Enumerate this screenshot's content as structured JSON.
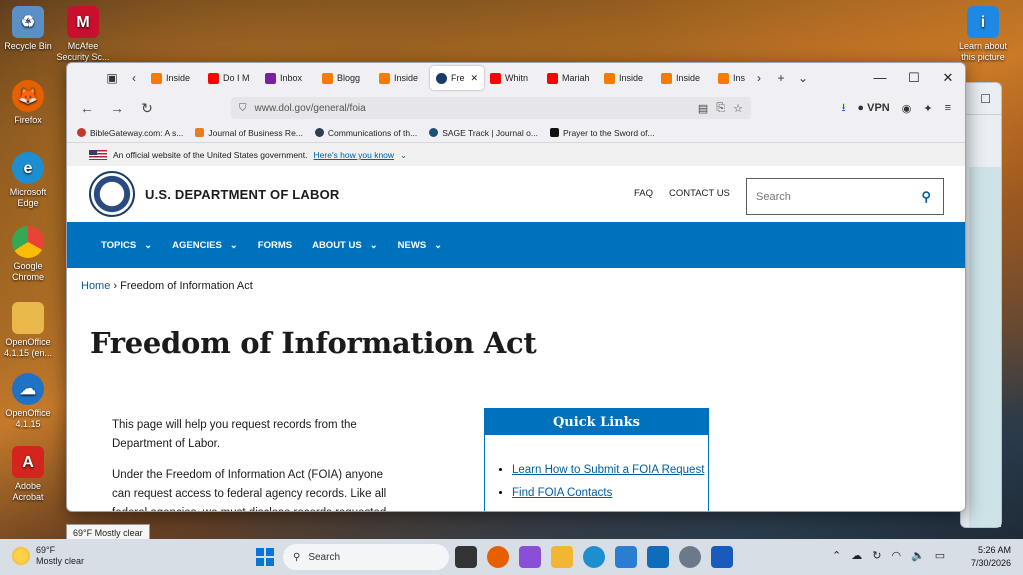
{
  "desktop": {
    "icons": [
      {
        "label": "Recycle Bin",
        "icon": "recycle-bin-icon",
        "color": "#5a8fc8"
      },
      {
        "label": "McAfee Security Sc...",
        "icon": "mcafee-icon",
        "color": "#c8102e"
      },
      {
        "label": "Firefox",
        "icon": "firefox-icon",
        "color": "#e66000"
      },
      {
        "label": "Microsoft Edge",
        "icon": "edge-icon",
        "color": "#1d8ecf"
      },
      {
        "label": "Google Chrome",
        "icon": "chrome-icon",
        "color": "#34a853"
      },
      {
        "label": "OpenOffice 4.1.15 (en...",
        "icon": "folder-icon",
        "color": "#e8b84a"
      },
      {
        "label": "OpenOffice 4.1.15",
        "icon": "openoffice-icon",
        "color": "#1f72c4"
      },
      {
        "label": "Adobe Acrobat",
        "icon": "acrobat-icon",
        "color": "#d4251c"
      },
      {
        "label": "Learn about this picture",
        "icon": "learn-picture-icon",
        "color": "#1e88e5"
      }
    ]
  },
  "browser": {
    "tabs": [
      {
        "label": "Inside",
        "color": "#f57c00",
        "active": false
      },
      {
        "label": "Do I M",
        "color": "#ff0000",
        "active": false
      },
      {
        "label": "Inbox",
        "color": "#7b1fa2",
        "active": false
      },
      {
        "label": "Blogg",
        "color": "#f57c00",
        "active": false
      },
      {
        "label": "Inside",
        "color": "#f57c00",
        "active": false
      },
      {
        "label": "Fre",
        "color": "#1a3a6a",
        "active": true
      },
      {
        "label": "Whitn",
        "color": "#ff0000",
        "active": false
      },
      {
        "label": "Mariah",
        "color": "#ff0000",
        "active": false
      },
      {
        "label": "Inside",
        "color": "#f57c00",
        "active": false
      },
      {
        "label": "Inside",
        "color": "#f57c00",
        "active": false
      },
      {
        "label": "Ins",
        "color": "#f57c00",
        "active": false
      }
    ],
    "url": "www.dol.gov/general/foia",
    "vpn_label": "VPN",
    "bookmarks": [
      {
        "label": "BibleGateway.com: A s...",
        "color": "#c0392b"
      },
      {
        "label": "Journal of Business Re...",
        "color": "#e67e22"
      },
      {
        "label": "Communications of th...",
        "color": "#2c3e50"
      },
      {
        "label": "SAGE Track | Journal o...",
        "color": "#1a5276"
      },
      {
        "label": "Prayer to the Sword of...",
        "color": "#111111"
      }
    ]
  },
  "page": {
    "gov_banner": {
      "text": "An official website of the United States government.",
      "link": "Here's how you know"
    },
    "agency_name": "U.S. DEPARTMENT OF LABOR",
    "header_links": {
      "faq": "FAQ",
      "contact": "CONTACT US"
    },
    "search_placeholder": "Search",
    "nav": [
      {
        "label": "TOPICS",
        "has_dropdown": true
      },
      {
        "label": "AGENCIES",
        "has_dropdown": true
      },
      {
        "label": "FORMS",
        "has_dropdown": false
      },
      {
        "label": "ABOUT US",
        "has_dropdown": true
      },
      {
        "label": "NEWS",
        "has_dropdown": true
      }
    ],
    "breadcrumb": {
      "home": "Home",
      "separator": "›",
      "current": "Freedom of Information Act"
    },
    "title": "Freedom of Information Act",
    "paragraphs": [
      "This page will help you request records from the Department of Labor.",
      "Under the Freedom of Information Act (FOIA) anyone can request access to federal agency records. Like all federal agencies, we must disclose records requested"
    ],
    "quick_links": {
      "heading": "Quick Links",
      "items": [
        "Learn How to Submit a FOIA Request",
        "Find FOIA Contacts"
      ]
    },
    "colors": {
      "brand_blue": "#0071bc",
      "link": "#005ea2"
    }
  },
  "weather_tooltip": "69°F Mostly clear",
  "taskbar": {
    "weather_temp": "69°F",
    "weather_desc": "Mostly clear",
    "search_label": "Search",
    "apps": [
      {
        "icon": "task-view-icon",
        "color": "#333333"
      },
      {
        "icon": "firefox-icon",
        "color": "#e66000"
      },
      {
        "icon": "copilot-icon",
        "color": "#8a4fd8"
      },
      {
        "icon": "file-explorer-icon",
        "color": "#f2b632"
      },
      {
        "icon": "edge-icon",
        "color": "#1d8ecf"
      },
      {
        "icon": "store-icon",
        "color": "#2b7cd3"
      },
      {
        "icon": "outlook-icon",
        "color": "#0f6cbd"
      },
      {
        "icon": "settings-icon",
        "color": "#6a7a8a"
      },
      {
        "icon": "word-icon",
        "color": "#185abd"
      }
    ],
    "time": "5:26 AM",
    "date": "7/30/2026"
  }
}
